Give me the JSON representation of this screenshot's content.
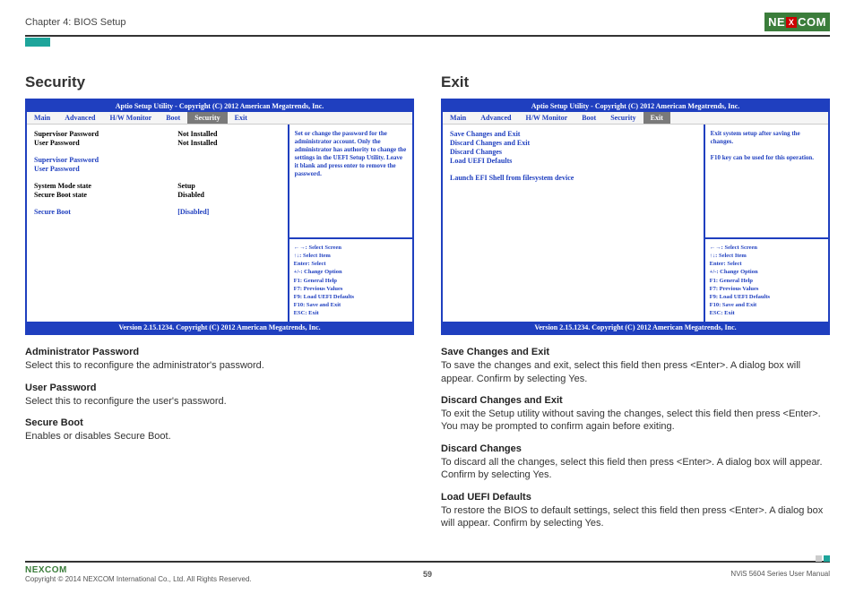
{
  "header": {
    "chapter": "Chapter 4: BIOS Setup",
    "logo_text_a": "NE",
    "logo_x": "X",
    "logo_text_b": "COM"
  },
  "left": {
    "heading": "Security",
    "bios": {
      "title": "Aptio Setup Utility - Copyright (C) 2012 American Megatrends, Inc.",
      "tabs": [
        "Main",
        "Advanced",
        "H/W Monitor",
        "Boot",
        "Security",
        "Exit"
      ],
      "active_tab": "Security",
      "rows_top_black": [
        {
          "label": "Supervisor Password",
          "value": "Not Installed"
        },
        {
          "label": "User Password",
          "value": "Not Installed"
        }
      ],
      "rows_blue1": [
        {
          "label": "Supervisor Password",
          "value": ""
        },
        {
          "label": "User Password",
          "value": ""
        }
      ],
      "rows_mid_black": [
        {
          "label": "System Mode state",
          "value": "Setup"
        },
        {
          "label": "Secure Boot state",
          "value": "Disabled"
        }
      ],
      "rows_blue2": [
        {
          "label": "Secure Boot",
          "value": "[Disabled]"
        }
      ],
      "help": "Set or change the password for the administrator account. Only the administrator has authority to change the settings in the UEFI Setup Utility. Leave it blank and press enter to remove the password.",
      "keys": [
        "←→: Select Screen",
        "↑↓: Select Item",
        "Enter: Select",
        "+/-: Change Option",
        "F1: General Help",
        "F7: Previous Values",
        "F9: Load UEFI Defaults",
        "F10: Save and Exit",
        "ESC: Exit"
      ],
      "footer": "Version 2.15.1234. Copyright (C) 2012 American Megatrends, Inc."
    },
    "desc": [
      {
        "h": "Administrator Password",
        "p": "Select this to reconfigure the administrator's password."
      },
      {
        "h": "User Password",
        "p": "Select this to reconfigure the user's password."
      },
      {
        "h": "Secure Boot",
        "p": "Enables or disables Secure Boot."
      }
    ]
  },
  "right": {
    "heading": "Exit",
    "bios": {
      "title": "Aptio Setup Utility - Copyright (C) 2012 American Megatrends, Inc.",
      "tabs": [
        "Main",
        "Advanced",
        "H/W Monitor",
        "Boot",
        "Security",
        "Exit"
      ],
      "active_tab": "Exit",
      "rows": [
        {
          "label": "Save Changes and Exit"
        },
        {
          "label": "Discard Changes and Exit"
        },
        {
          "label": "Discard Changes"
        },
        {
          "label": "Load UEFI Defaults"
        },
        {
          "label": ""
        },
        {
          "label": "Launch EFI Shell from filesystem device"
        }
      ],
      "help": "Exit system setup after saving the changes.\n\nF10 key can be used for this operation.",
      "keys": [
        "←→: Select Screen",
        "↑↓: Select Item",
        "Enter: Select",
        "+/-: Change Option",
        "F1: General Help",
        "F7: Previous Values",
        "F9: Load UEFI Defaults",
        "F10: Save and Exit",
        "ESC: Exit"
      ],
      "footer": "Version 2.15.1234. Copyright (C) 2012 American Megatrends, Inc."
    },
    "desc": [
      {
        "h": "Save Changes and Exit",
        "p": "To save the changes and exit, select this field then press <Enter>. A dialog box will appear. Confirm by selecting Yes."
      },
      {
        "h": "Discard Changes and Exit",
        "p": "To exit the Setup utility without saving the changes, select this field then press <Enter>. You may be prompted to confirm again before exiting."
      },
      {
        "h": "Discard Changes",
        "p": "To discard all the changes, select this field then press <Enter>. A dialog box will appear. Confirm by selecting Yes."
      },
      {
        "h": "Load UEFI Defaults",
        "p": "To restore the BIOS to default settings, select this field then press <Enter>. A dialog box will appear. Confirm by selecting Yes."
      }
    ]
  },
  "footer": {
    "logo": "NEXCOM",
    "copyright": "Copyright © 2014 NEXCOM International Co., Ltd. All Rights Reserved.",
    "page": "59",
    "manual": "NViS 5604 Series User Manual"
  }
}
